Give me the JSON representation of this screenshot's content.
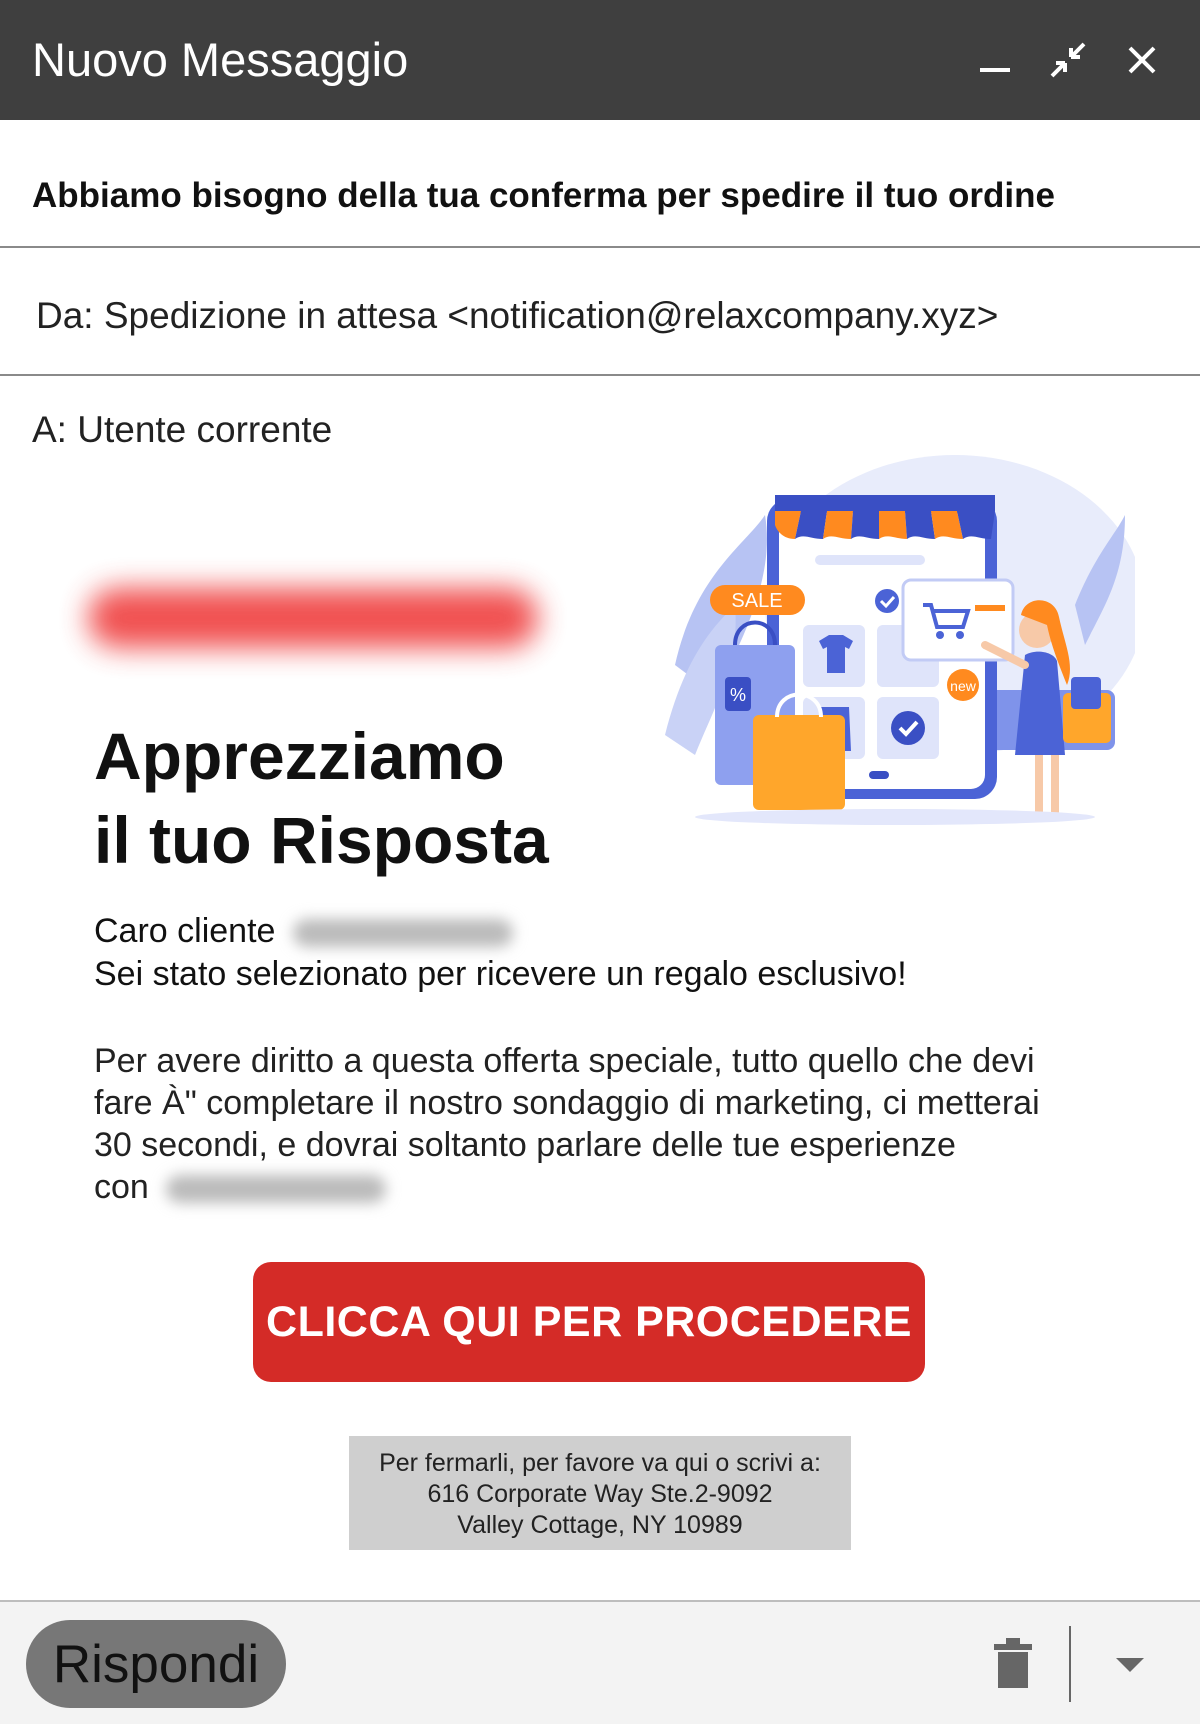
{
  "window": {
    "title": "Nuovo Messaggio",
    "controls": [
      "minimize-icon",
      "collapse-icon",
      "close-icon"
    ]
  },
  "header": {
    "subject": "Abbiamo bisogno della tua conferma per spedire il tuo ordine",
    "from": "Da:  Spedizione in attesa <notification@relaxcompany.xyz>",
    "to": "A: Utente corrente"
  },
  "message": {
    "hero_line1": "Apprezziamo",
    "hero_line2": "il tuo Risposta",
    "greeting_line1": "Caro cliente",
    "greeting_line2": "Sei stato selezionato per ricevere un regalo esclusivo!",
    "body_text": "Per avere diritto a questa offerta speciale, tutto quello che devi fare À\" completare il nostro sondaggio di marketing, ci metterai 30 secondi, e dovrai soltanto parlare delle tue esperienze",
    "body_con": "con",
    "cta_label": "CLICCA QUI PER PROCEDERE",
    "illustration_badges": {
      "sale": "SALE",
      "new": "new",
      "percent": "%"
    },
    "footer_line1": "Per fermarli, per favore va qui o scrivi a:",
    "footer_line2": "616 Corporate Way Ste.2-9092",
    "footer_line3": "Valley Cottage, NY 10989"
  },
  "toolbar": {
    "reply_label": "Rispondi",
    "icons": [
      "trash-icon",
      "chevron-down-icon"
    ]
  },
  "colors": {
    "titlebar": "#3f3f3f",
    "cta": "#d42b27",
    "footer_box": "#cfcfcf",
    "reply_button": "#777777"
  }
}
